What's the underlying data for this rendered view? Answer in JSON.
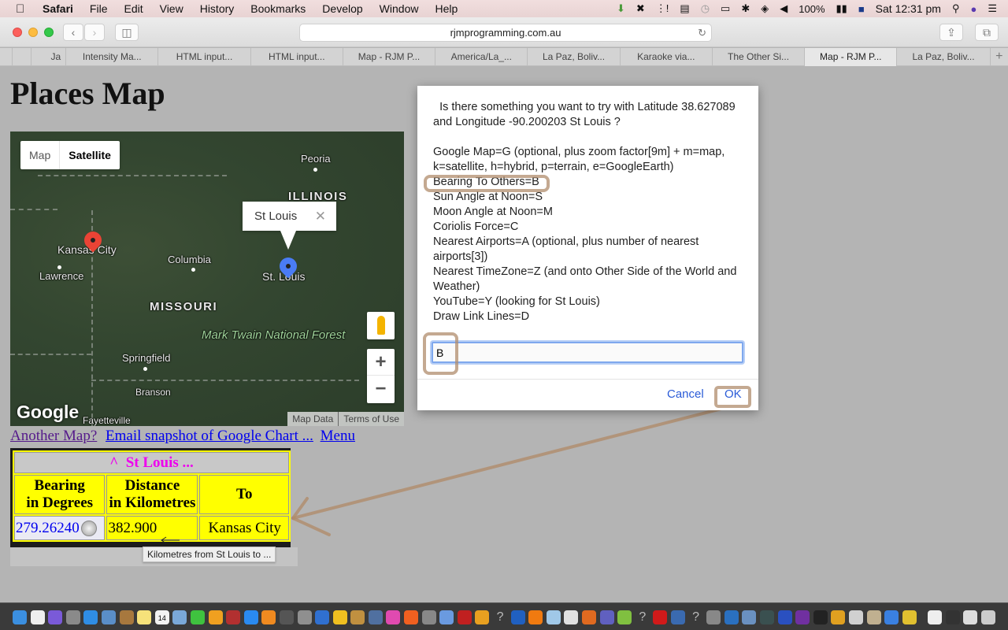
{
  "menubar": {
    "app": "Safari",
    "items": [
      "File",
      "Edit",
      "View",
      "History",
      "Bookmarks",
      "Develop",
      "Window",
      "Help"
    ],
    "battery": "100%",
    "clock": "Sat 12:31 pm"
  },
  "browser": {
    "url": "rjmprogramming.com.au",
    "tabs": [
      {
        "label": "Ja",
        "active": false
      },
      {
        "label": "Intensity Ma...",
        "active": false
      },
      {
        "label": "HTML input...",
        "active": false
      },
      {
        "label": "HTML input...",
        "active": false
      },
      {
        "label": "Map - RJM P...",
        "active": false
      },
      {
        "label": "America/La_...",
        "active": false
      },
      {
        "label": "La Paz, Boliv...",
        "active": false
      },
      {
        "label": "Karaoke via...",
        "active": false
      },
      {
        "label": "The Other Si...",
        "active": false
      },
      {
        "label": "Map - RJM P...",
        "active": true
      },
      {
        "label": "La Paz, Boliv...",
        "active": false
      }
    ]
  },
  "page": {
    "title": "Places Map",
    "map": {
      "type_buttons": {
        "map": "Map",
        "satellite": "Satellite"
      },
      "selected_type": "Satellite",
      "info_window": "St Louis",
      "labels": {
        "peoria": "Peoria",
        "illinois": "ILLINOIS",
        "kansas_city": "Kansas City",
        "columbia": "Columbia",
        "lawrence": "Lawrence",
        "st_louis": "St. Louis",
        "missouri": "MISSOURI",
        "forest": "Mark Twain National Forest",
        "springfield": "Springfield",
        "branson": "Branson",
        "fayetteville": "Fayetteville"
      },
      "logo": "Google",
      "map_data": "Map Data",
      "terms": "Terms of Use",
      "zoom_in": "+",
      "zoom_out": "−"
    },
    "links": {
      "another_map": "Another Map?",
      "email_snapshot": "Email snapshot of Google Chart ...",
      "menu": "Menu"
    },
    "results": {
      "caption": "^  St Louis ...",
      "headers": [
        "Bearing in Degrees",
        "Distance in Kilometres",
        "To"
      ],
      "header_lines": [
        [
          "Bearing",
          "in Degrees"
        ],
        [
          "Distance",
          "in Kilometres"
        ],
        [
          "To",
          ""
        ]
      ],
      "rows": [
        {
          "bearing": "279.26240",
          "distance": "382.900",
          "to": "Kansas City"
        }
      ],
      "tooltip": "Kilometres from St Louis to ..."
    }
  },
  "dialog": {
    "prompt_lines": [
      "  Is there something you want to try with Latitude 38.627089 and Longitude -90.200203 St Louis ?",
      "",
      "Google Map=G (optional, plus zoom factor[9m] + m=map, k=satellite, h=hybrid, p=terrain, e=GoogleEarth)",
      "Bearing To Others=B",
      "Sun Angle at Noon=S",
      "Moon Angle at Noon=M",
      "Coriolis Force=C",
      "Nearest Airports=A (optional, plus number of nearest airports[3])",
      "Nearest TimeZone=Z (and onto Other Side of the World and Weather)",
      "YouTube=Y (looking for St Louis)",
      "Draw Link Lines=D"
    ],
    "input_value": "B",
    "cancel_label": "Cancel",
    "ok_label": "OK"
  },
  "colors": {
    "table_bg": "#ffff00",
    "caption_text": "#ee00ee",
    "link": "#0000ee",
    "visited_link": "#551a8b",
    "dialog_button": "#2a5bd7",
    "annotation": "#b08c6c"
  },
  "dock": {
    "icons": [
      "finder-icon",
      "file-icon",
      "siri-icon",
      "launchpad-icon",
      "safari-icon",
      "preview-icon",
      "contacts-icon",
      "notes-icon",
      "calendar-icon",
      "photos-app-icon",
      "facetime-icon",
      "photos-icon",
      "photo-booth-icon",
      "app-store-icon",
      "ibooks-icon",
      "system-prefs-icon",
      "grab-icon",
      "xcode-icon",
      "wikipedia-icon",
      "gimp-icon",
      "image-capture-icon",
      "itunes-icon",
      "avast-icon",
      "network-icon",
      "preview2-icon",
      "filezilla-icon",
      "chrome-icon",
      "help-icon",
      "quicktime-icon",
      "vlc-icon",
      "cube-icon",
      "textedit-icon",
      "firefox-icon",
      "php-icon",
      "android-studio-icon",
      "unknown-icon",
      "opera-icon",
      "virtualbox-icon",
      "unknown2-icon",
      "automator-icon",
      "vscode-icon",
      "image-icon",
      "grid-icon",
      "swift-icon",
      "github-icon",
      "terminal-icon",
      "colors-icon",
      "drop-icon",
      "textedit2-icon",
      "folder-icon",
      "keychain-icon",
      "doc1-icon",
      "doc2-icon",
      "doc3-icon",
      "trash-icon"
    ],
    "calendar_day": "14"
  }
}
